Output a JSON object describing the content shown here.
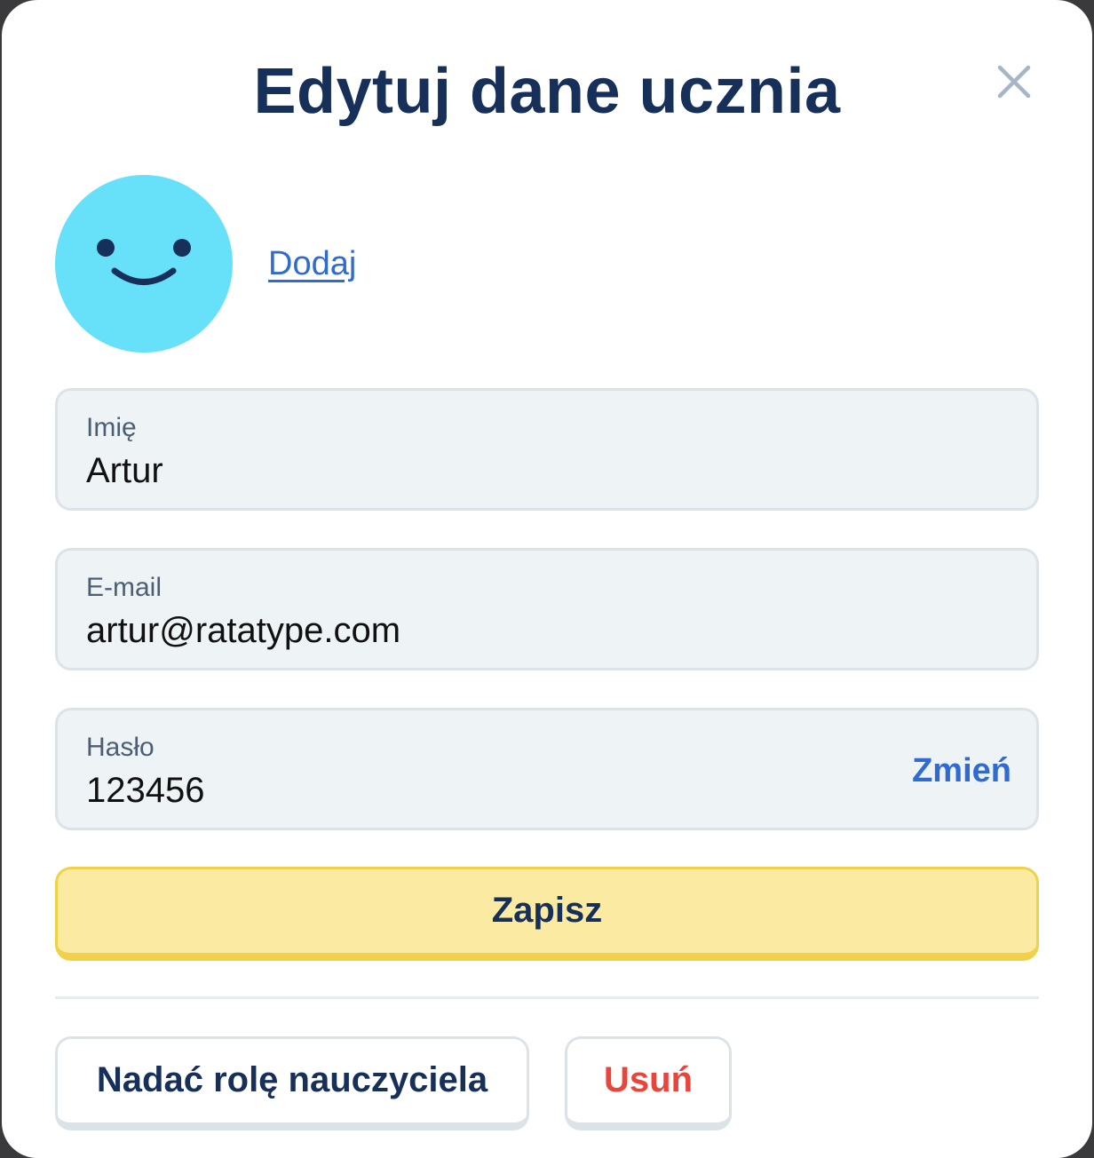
{
  "modal": {
    "title": "Edytuj dane ucznia"
  },
  "avatar": {
    "add_label": "Dodaj",
    "color": "#67e0f9"
  },
  "fields": {
    "name": {
      "label": "Imię",
      "value": "Artur"
    },
    "email": {
      "label": "E-mail",
      "value": "artur@ratatype.com"
    },
    "password": {
      "label": "Hasło",
      "value": "123456",
      "action_label": "Zmień"
    }
  },
  "actions": {
    "save_label": "Zapisz",
    "teacher_role_label": "Nadać rolę nauczyciela",
    "delete_label": "Usuń"
  },
  "colors": {
    "title": "#17305a",
    "link": "#2f6bd0",
    "save_bg": "#fbeaa2",
    "save_border": "#f1d04b",
    "delete_text": "#e8453b",
    "field_bg": "#eef3f6"
  },
  "icons": {
    "close": "close-icon",
    "avatar": "smiley-face-icon"
  }
}
